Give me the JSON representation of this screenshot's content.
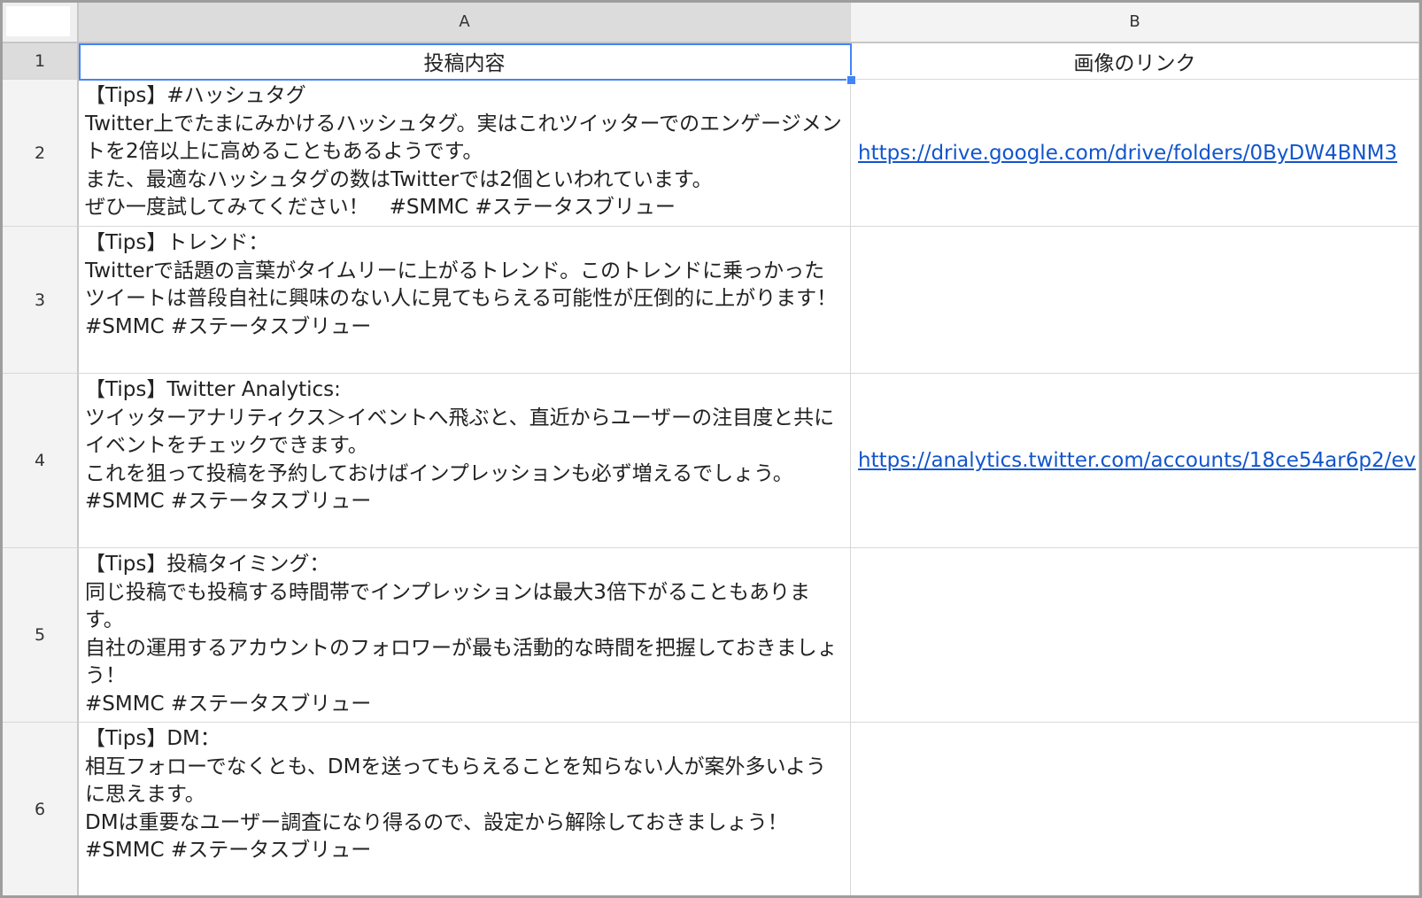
{
  "columns": [
    {
      "label": "A"
    },
    {
      "label": "B"
    }
  ],
  "rows": [
    {
      "number": "1",
      "a": "投稿内容",
      "b": "画像のリンク"
    },
    {
      "number": "2",
      "a": "【Tips】#ハッシュタグ\nTwitter上でたまにみかけるハッシュタグ。実はこれツイッターでのエンゲージメントを2倍以上に高めることもあるようです。\nまた、最適なハッシュタグの数はTwitterでは2個といわれています。\nぜひ一度試してみてください！　#SMMC #ステータスブリュー",
      "b": "https://drive.google.com/drive/folders/0ByDW4BNM3"
    },
    {
      "number": "3",
      "a": "【Tips】トレンド：\nTwitterで話題の言葉がタイムリーに上がるトレンド。このトレンドに乗っかったツイートは普段自社に興味のない人に見てもらえる可能性が圧倒的に上がります！\n#SMMC #ステータスブリュー",
      "b": ""
    },
    {
      "number": "4",
      "a": "【Tips】Twitter Analytics:\nツイッターアナリティクス＞イベントへ飛ぶと、直近からユーザーの注目度と共にイベントをチェックできます。\nこれを狙って投稿を予約しておけばインプレッションも必ず増えるでしょう。\n#SMMC #ステータスブリュー",
      "b": "https://analytics.twitter.com/accounts/18ce54ar6p2/ev"
    },
    {
      "number": "5",
      "a": "【Tips】投稿タイミング：\n同じ投稿でも投稿する時間帯でインプレッションは最大3倍下がることもあります。\n自社の運用するアカウントのフォロワーが最も活動的な時間を把握しておきましょう！\n#SMMC #ステータスブリュー",
      "b": ""
    },
    {
      "number": "6",
      "a": "【Tips】DM：\n相互フォローでなくとも、DMを送ってもらえることを知らない人が案外多いように思えます。\nDMは重要なユーザー調査になり得るので、設定から解除しておきましょう！\n#SMMC #ステータスブリュー",
      "b": ""
    }
  ],
  "selection": {
    "cell": "A1"
  },
  "colors": {
    "selection": "#4285f4",
    "link": "#1155cc",
    "header_bg": "#f3f3f3",
    "selected_header_bg": "#dcdcdc"
  }
}
